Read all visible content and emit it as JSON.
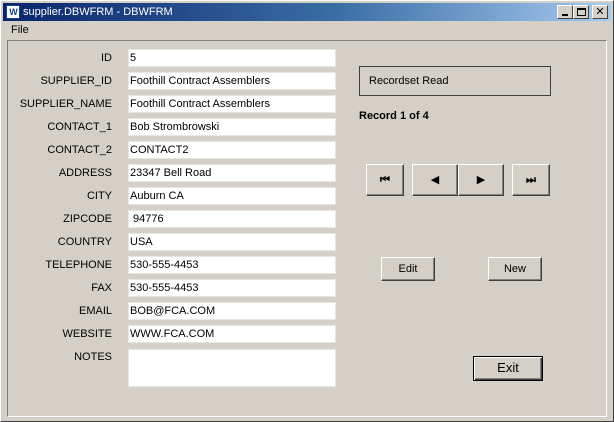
{
  "window": {
    "title": "supplier.DBWFRM - DBWFRM",
    "app_icon_text": "W",
    "minimize_icon": "minimize-icon",
    "maximize_icon": "maximize-icon",
    "close_glyph": "✕"
  },
  "menu": {
    "file_label": "File"
  },
  "form": {
    "fields": [
      {
        "label": "ID",
        "value": "5"
      },
      {
        "label": "SUPPLIER_ID",
        "value": "Foothill Contract Assemblers"
      },
      {
        "label": "SUPPLIER_NAME",
        "value": "Foothill Contract Assemblers"
      },
      {
        "label": "CONTACT_1",
        "value": "Bob Strombrowski"
      },
      {
        "label": "CONTACT_2",
        "value": "CONTACT2"
      },
      {
        "label": "ADDRESS",
        "value": "23347 Bell Road"
      },
      {
        "label": "CITY",
        "value": "Auburn CA"
      },
      {
        "label": "ZIPCODE",
        "value": " 94776"
      },
      {
        "label": "COUNTRY",
        "value": "USA"
      },
      {
        "label": "TELEPHONE",
        "value": "530-555-4453"
      },
      {
        "label": "FAX",
        "value": "530-555-4453"
      },
      {
        "label": "EMAIL",
        "value": "BOB@FCA.COM"
      },
      {
        "label": "WEBSITE",
        "value": "WWW.FCA.COM"
      }
    ],
    "notes": {
      "label": "NOTES",
      "value": ""
    }
  },
  "status": {
    "text": "Recordset Read",
    "record_text": "Record 1 of 4"
  },
  "navigation": {
    "first_glyph": "⏮",
    "prev_glyph": "◀",
    "next_glyph": "▶",
    "last_glyph": "⏭"
  },
  "buttons": {
    "edit": "Edit",
    "new": "New",
    "exit": "Exit"
  }
}
